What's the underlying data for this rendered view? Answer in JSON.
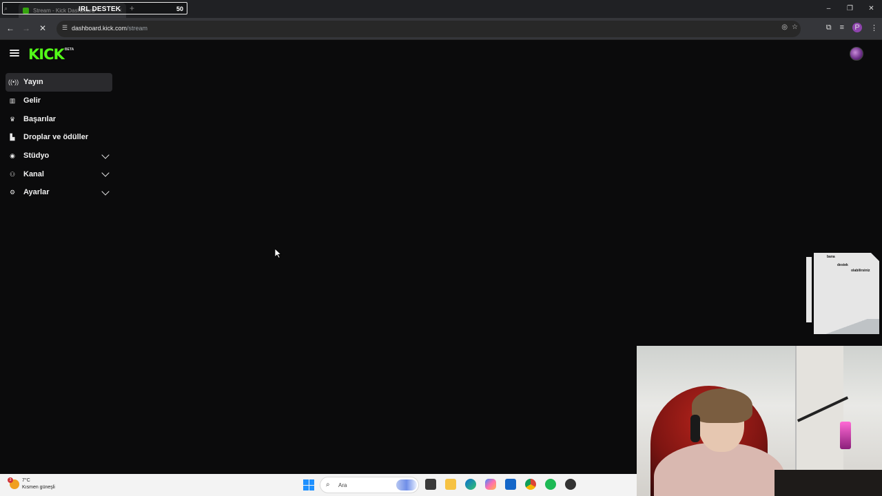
{
  "browser": {
    "tab_title": "Stream - Kick Dashboard",
    "url_host": "dashboard.kick.com",
    "url_path": "/stream",
    "new_tab_symbol": "+"
  },
  "overlay": {
    "title": "IRL DESTEK",
    "count": "50"
  },
  "header": {
    "logo_text": "KICK",
    "beta_label": "BETA"
  },
  "sidebar": {
    "items": [
      {
        "label": "Yayın",
        "icon": "broadcast-icon"
      },
      {
        "label": "Gelir",
        "icon": "revenue-icon"
      },
      {
        "label": "Başarılar",
        "icon": "trophy-icon"
      },
      {
        "label": "Droplar ve ödüller",
        "icon": "drops-icon"
      },
      {
        "label": "Stüdyo",
        "icon": "studio-icon"
      },
      {
        "label": "Kanal",
        "icon": "channel-icon"
      },
      {
        "label": "Ayarlar",
        "icon": "settings-icon"
      }
    ]
  },
  "support_card": {
    "line1": "bana",
    "line2": "destek",
    "line3": "olabilirsiniz"
  },
  "taskbar": {
    "temperature": "7°C",
    "weather_desc": "Kısmen güneşli",
    "weather_badge": "3",
    "search_placeholder": "Ara"
  },
  "colors": {
    "brand": "#53fc18",
    "background": "#0b0b0c",
    "active_item": "#2a2a2d"
  }
}
